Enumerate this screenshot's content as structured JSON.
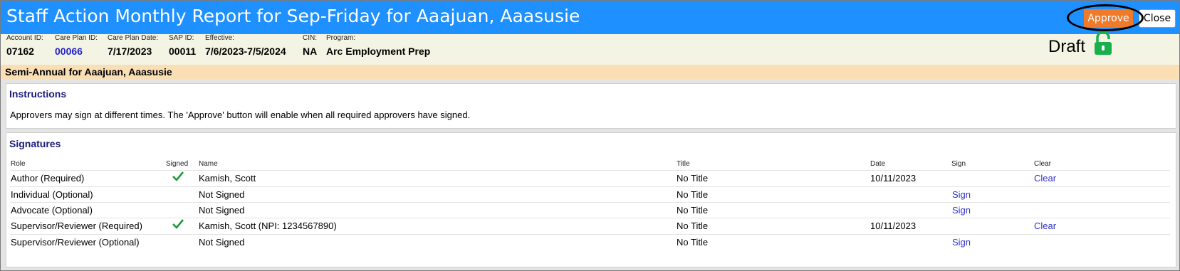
{
  "window": {
    "title": "Staff Action Monthly Report for Sep-Friday for Aaajuan, Aaasusie",
    "approve_label": "Approve",
    "close_label": "Close",
    "accent": "#1e90ff",
    "approve_color": "#ee7a2a"
  },
  "info": {
    "fields": [
      {
        "label": "Account ID:",
        "value": "07162"
      },
      {
        "label": "Care Plan ID:",
        "value": "00066"
      },
      {
        "label": "Care Plan Date:",
        "value": "7/17/2023"
      },
      {
        "label": "SAP ID:",
        "value": "00011"
      },
      {
        "label": "Effective:",
        "value": "7/6/2023-7/5/2024"
      },
      {
        "label": "CIN:",
        "value": "NA"
      },
      {
        "label": "Program:",
        "value": "Arc Employment Prep"
      }
    ],
    "status": "Draft",
    "status_icon": "unlocked-padlock-icon"
  },
  "section": {
    "heading": "Semi-Annual for Aaajuan, Aaasusie"
  },
  "instructions": {
    "title": "Instructions",
    "text": "Approvers may sign at different times. The 'Approve' button will enable when all required approvers have signed."
  },
  "signatures": {
    "title": "Signatures",
    "columns": {
      "role": "Role",
      "signed": "Signed",
      "name": "Name",
      "title": "Title",
      "date": "Date",
      "sign": "Sign",
      "clear": "Clear"
    },
    "rows": [
      {
        "role": "Author (Required)",
        "signed": true,
        "name": "Kamish, Scott",
        "title": "No Title",
        "date": "10/11/2023",
        "sign": "",
        "clear": "Clear"
      },
      {
        "role": "Individual (Optional)",
        "signed": false,
        "name": "Not Signed",
        "title": "No Title",
        "date": "",
        "sign": "Sign",
        "clear": ""
      },
      {
        "role": "Advocate (Optional)",
        "signed": false,
        "name": "Not Signed",
        "title": "No Title",
        "date": "",
        "sign": "Sign",
        "clear": ""
      },
      {
        "role": "Supervisor/Reviewer (Required)",
        "signed": true,
        "name": "Kamish, Scott (NPI: 1234567890)",
        "title": "No Title",
        "date": "10/11/2023",
        "sign": "",
        "clear": "Clear"
      },
      {
        "role": "Supervisor/Reviewer (Optional)",
        "signed": false,
        "name": "Not Signed",
        "title": "No Title",
        "date": "",
        "sign": "Sign",
        "clear": ""
      }
    ]
  }
}
